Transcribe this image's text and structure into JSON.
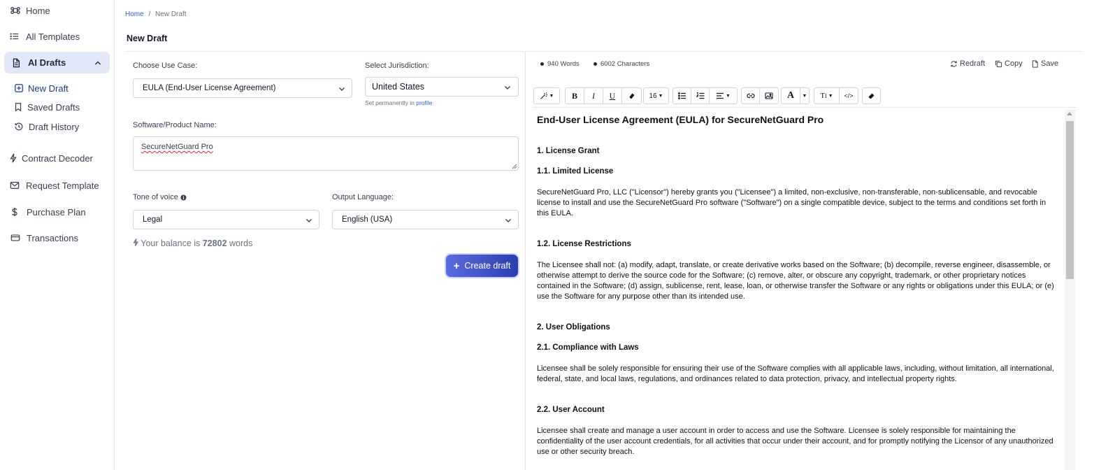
{
  "sidebar": {
    "home": "Home",
    "all_templates": "All Templates",
    "ai_drafts": "AI Drafts",
    "new_draft": "New Draft",
    "saved_drafts": "Saved Drafts",
    "draft_history": "Draft History",
    "contract_decoder": "Contract Decoder",
    "request_template": "Request Template",
    "purchase_plan": "Purchase Plan",
    "transactions": "Transactions"
  },
  "breadcrumb": {
    "home": "Home",
    "sep": "/",
    "current": "New Draft"
  },
  "page_title": "New Draft",
  "form": {
    "use_case_label": "Choose Use Case:",
    "use_case_value": "EULA (End-User License Agreement)",
    "jurisdiction_label": "Select Jurisdiction:",
    "jurisdiction_value": "United States",
    "jurisdiction_hint": "Set permanently in",
    "jurisdiction_hint_link": "profile",
    "product_label": "Software/Product Name:",
    "product_value": "SecureNetGuard Pro",
    "tone_label": "Tone of voice",
    "tone_value": "Legal",
    "language_label": "Output Language:",
    "language_value": "English (USA)",
    "balance_prefix": "Your balance is",
    "balance_value": "72802",
    "balance_suffix": "words",
    "create_label": "Create draft"
  },
  "editor": {
    "words": "940 Words",
    "characters": "6002 Characters",
    "redraft": "Redraft",
    "copy": "Copy",
    "save": "Save",
    "font_size": "16"
  },
  "document": {
    "title": "End-User License Agreement (EULA) for SecureNetGuard Pro",
    "s1": "1. License Grant",
    "s1_1": "1.1. Limited License",
    "p1": "SecureNetGuard Pro, LLC (\"Licensor\") hereby grants you (\"Licensee\") a limited, non-exclusive, non-transferable, non-sublicensable, and revocable license to install and use the SecureNetGuard Pro software (\"Software\") on a single compatible device, subject to the terms and conditions set forth in this EULA.",
    "s1_2": "1.2. License Restrictions",
    "p2": "The Licensee shall not: (a) modify, adapt, translate, or create derivative works based on the Software; (b) decompile, reverse engineer, disassemble, or otherwise attempt to derive the source code for the Software; (c) remove, alter, or obscure any copyright, trademark, or other proprietary notices contained in the Software; (d) assign, sublicense, rent, lease, loan, or otherwise transfer the Software or any rights or obligations under this EULA; or (e) use the Software for any purpose other than its intended use.",
    "s2": "2. User Obligations",
    "s2_1": "2.1. Compliance with Laws",
    "p3": "Licensee shall be solely responsible for ensuring their use of the Software complies with all applicable laws, including, without limitation, all international, federal, state, and local laws, regulations, and ordinances related to data protection, privacy, and intellectual property rights.",
    "s2_2": "2.2. User Account",
    "p4": "Licensee shall create and manage a user account in order to access and use the Software. Licensee is solely responsible for maintaining the confidentiality of the user account credentials, for all activities that occur under their account, and for promptly notifying the Licensor of any unauthorized use or other security breach."
  }
}
